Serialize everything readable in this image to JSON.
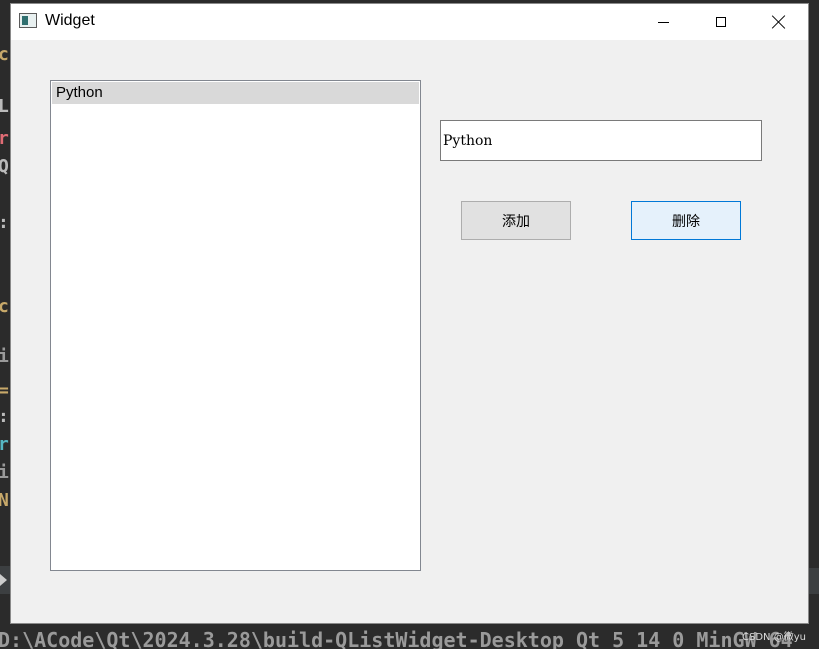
{
  "window": {
    "title": "Widget"
  },
  "list": {
    "items": [
      "Python"
    ]
  },
  "line_edit": {
    "value": "Python"
  },
  "buttons": {
    "add_label": "添加",
    "delete_label": "删除"
  },
  "background": {
    "bottom_path_text": "D:\\ACode\\Qt\\2024.3.28\\build-QListWidget-Desktop_Qt_5_14_0_MinGW_64"
  },
  "watermark": "CSDN @微yu",
  "colors": {
    "selected_item": "#d9d9d9",
    "focus_border": "#0078d7",
    "window_bg": "#f0f0f0"
  }
}
